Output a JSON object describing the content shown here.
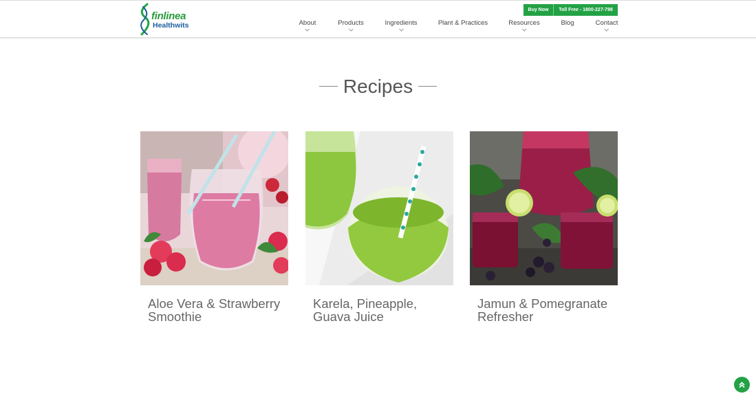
{
  "header": {
    "logo": {
      "line1": "finlinea",
      "line2": "Healthwits"
    },
    "utility": {
      "buy_now": "Buy Now",
      "toll_free": "Toll Free - 1800-227-798"
    },
    "nav": [
      {
        "label": "About",
        "has_dropdown": true
      },
      {
        "label": "Products",
        "has_dropdown": true
      },
      {
        "label": "Ingredients",
        "has_dropdown": true
      },
      {
        "label": "Plant & Practices",
        "has_dropdown": false
      },
      {
        "label": "Resources",
        "has_dropdown": true
      },
      {
        "label": "Blog",
        "has_dropdown": false
      },
      {
        "label": "Contact",
        "has_dropdown": true
      }
    ]
  },
  "recipes": {
    "title": "Recipes",
    "cards": [
      {
        "caption": "Aloe Vera & Strawberry Smoothie"
      },
      {
        "caption": "Karela, Pineapple, Guava Juice"
      },
      {
        "caption": "Jamun & Pomegranate Refresher"
      }
    ]
  },
  "colors": {
    "brand_green": "#23a245",
    "brand_blue": "#1b5e9c"
  },
  "icons": {
    "chevron": "chevron-down-icon",
    "to_top": "double-chevron-up-icon"
  }
}
